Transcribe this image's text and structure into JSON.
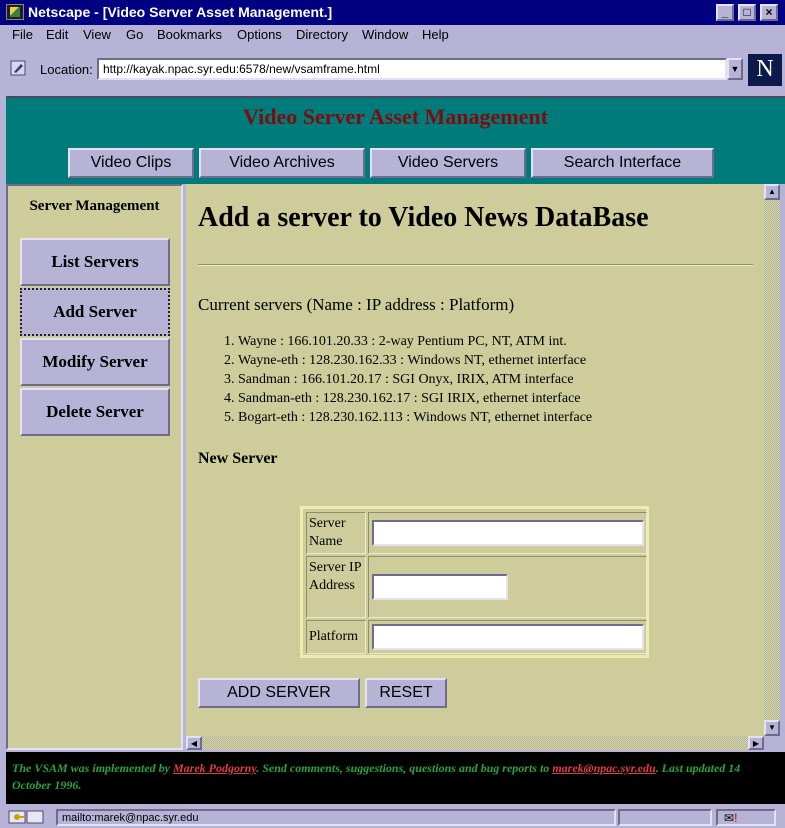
{
  "window": {
    "title": "Netscape - [Video Server Asset Management.]",
    "minimize_label": "_",
    "maximize_label": "□",
    "close_label": "×"
  },
  "menu": [
    "File",
    "Edit",
    "View",
    "Go",
    "Bookmarks",
    "Options",
    "Directory",
    "Window",
    "Help"
  ],
  "location": {
    "label": "Location:",
    "url": "http://kayak.npac.syr.edu:6578/new/vsamframe.html",
    "logo": "N"
  },
  "header": {
    "title": "Video Server Asset Management",
    "nav": [
      "Video Clips",
      "Video Archives",
      "Video Servers",
      "Search Interface"
    ]
  },
  "sidebar": {
    "title": "Server Management",
    "items": [
      "List Servers",
      "Add Server",
      "Modify Server",
      "Delete Server"
    ],
    "active": "Add Server"
  },
  "main": {
    "heading": "Add a server to Video News DataBase",
    "current_title": "Current servers (Name : IP address : Platform)",
    "servers": [
      "Wayne : 166.101.20.33 : 2-way Pentium PC, NT, ATM int.",
      "Wayne-eth : 128.230.162.33 : Windows NT, ethernet interface",
      "Sandman : 166.101.20.17 : SGI Onyx, IRIX, ATM interface",
      "Sandman-eth : 128.230.162.17 : SGI IRIX, ethernet interface",
      "Bogart-eth : 128.230.162.113 : Windows NT, ethernet interface"
    ],
    "new_title": "New Server",
    "form": {
      "server_name_label": "Server Name",
      "server_ip_label": "Server IP Address",
      "platform_label": "Platform",
      "server_name_value": "",
      "server_ip_value": "",
      "platform_value": ""
    },
    "add_button": "ADD SERVER",
    "reset_button": "RESET"
  },
  "footer": {
    "prefix": "The VSAM was implemented by ",
    "author": "Marek Podgorny",
    "middle": ". Send comments, suggestions, questions and bug reports to ",
    "email": "marek@npac.syr.edu",
    "suffix": ". Last updated 14 October 1996."
  },
  "status": {
    "text": "mailto:marek@npac.syr.edu",
    "mail_indicator": "!"
  },
  "colors": {
    "chrome": "#b6b3d6",
    "titlebar": "#000080",
    "header_bg": "#007b7b",
    "title_text": "#7d0d0d",
    "content_bg": "#cdcc9a",
    "footer_text": "#2aa43a",
    "footer_link": "#d94040"
  }
}
